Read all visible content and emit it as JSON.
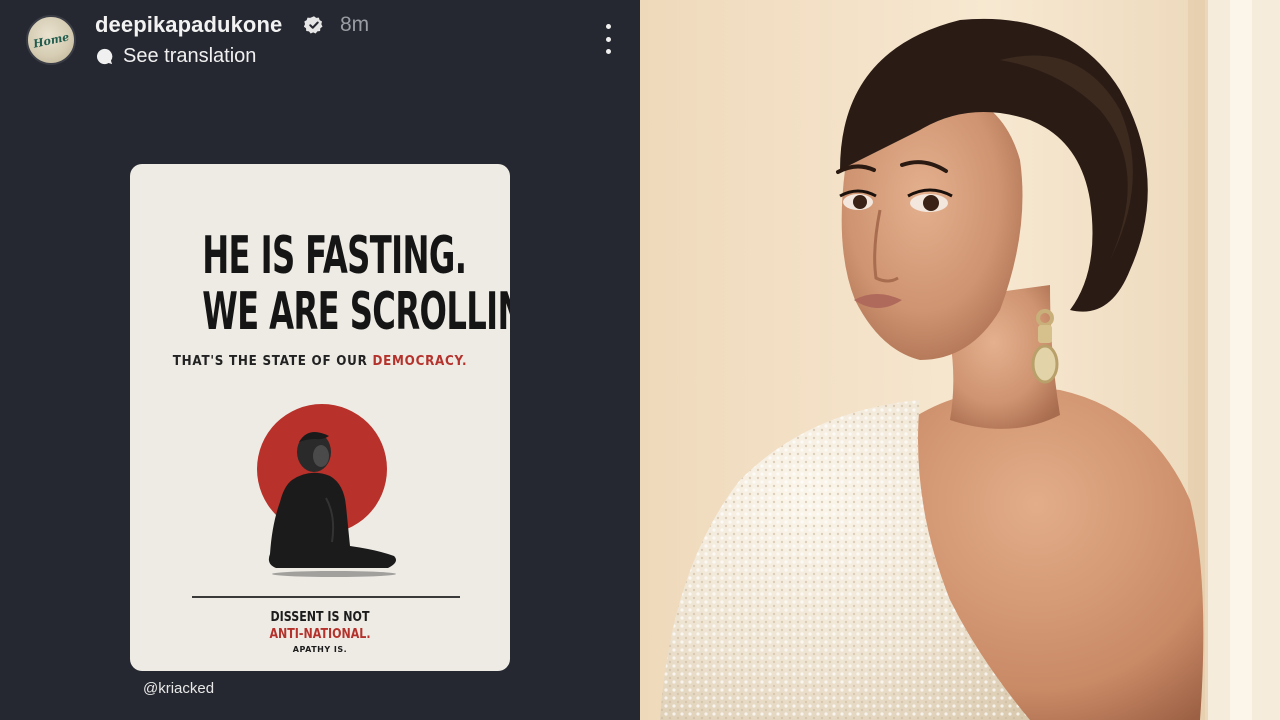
{
  "story": {
    "username": "deepikapadukone",
    "time_ago": "8m",
    "avatar_text": "Home",
    "translate_label": "See translation",
    "credit": "@kriacked"
  },
  "poster": {
    "headline_line1": "HE IS FASTING.",
    "headline_line2": "WE ARE SCROLLING.",
    "subline_prefix": "THAT'S THE STATE OF OUR",
    "subline_highlight": "DEMOCRACY.",
    "footer_line1": "DISSENT IS NOT",
    "footer_line2": "ANTI-NATIONAL.",
    "footer_line3": "APATHY IS.",
    "accent_color": "#b5322c"
  },
  "icons": {
    "verified": "verified-badge-icon",
    "menu": "more-options-icon",
    "translate": "speech-bubble-icon"
  }
}
